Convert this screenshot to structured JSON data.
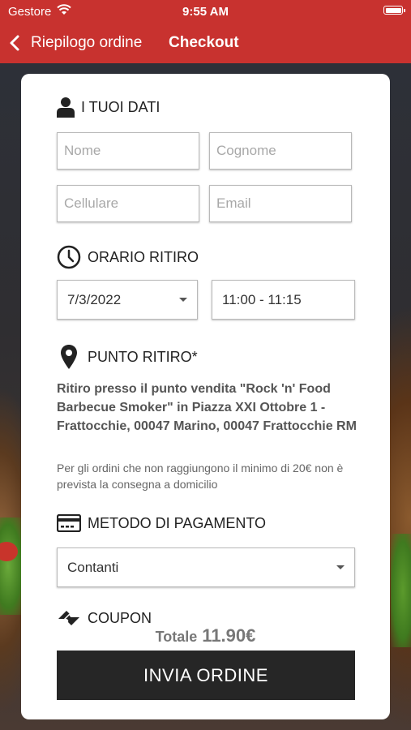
{
  "status_bar": {
    "carrier": "Gestore",
    "time": "9:55 AM"
  },
  "nav": {
    "back_label": "Riepilogo ordine",
    "title": "Checkout"
  },
  "sections": {
    "personal": {
      "title": "I TUOI DATI",
      "first_name_placeholder": "Nome",
      "last_name_placeholder": "Cognome",
      "phone_placeholder": "Cellulare",
      "email_placeholder": "Email"
    },
    "pickup_time": {
      "title": "ORARIO RITIRO",
      "date": "7/3/2022",
      "time_slot": "11:00 - 11:15"
    },
    "pickup_point": {
      "title": "PUNTO RITIRO*",
      "address": "Ritiro presso il punto vendita \"Rock 'n' Food Barbecue Smoker\" in Piazza XXI Ottobre 1 - Frattocchie, 00047 Marino, 00047 Frattocchie RM",
      "note": "Per gli ordini che non raggiungono il minimo di 20€ non è prevista la consegna a domicilio"
    },
    "payment": {
      "title": "METODO DI PAGAMENTO",
      "selected": "Contanti"
    },
    "coupon": {
      "title": "COUPON"
    }
  },
  "total": {
    "label": "Totale",
    "value": "11.90€"
  },
  "submit_label": "INVIA ORDINE",
  "colors": {
    "header": "#c8322f",
    "button": "#262626"
  }
}
